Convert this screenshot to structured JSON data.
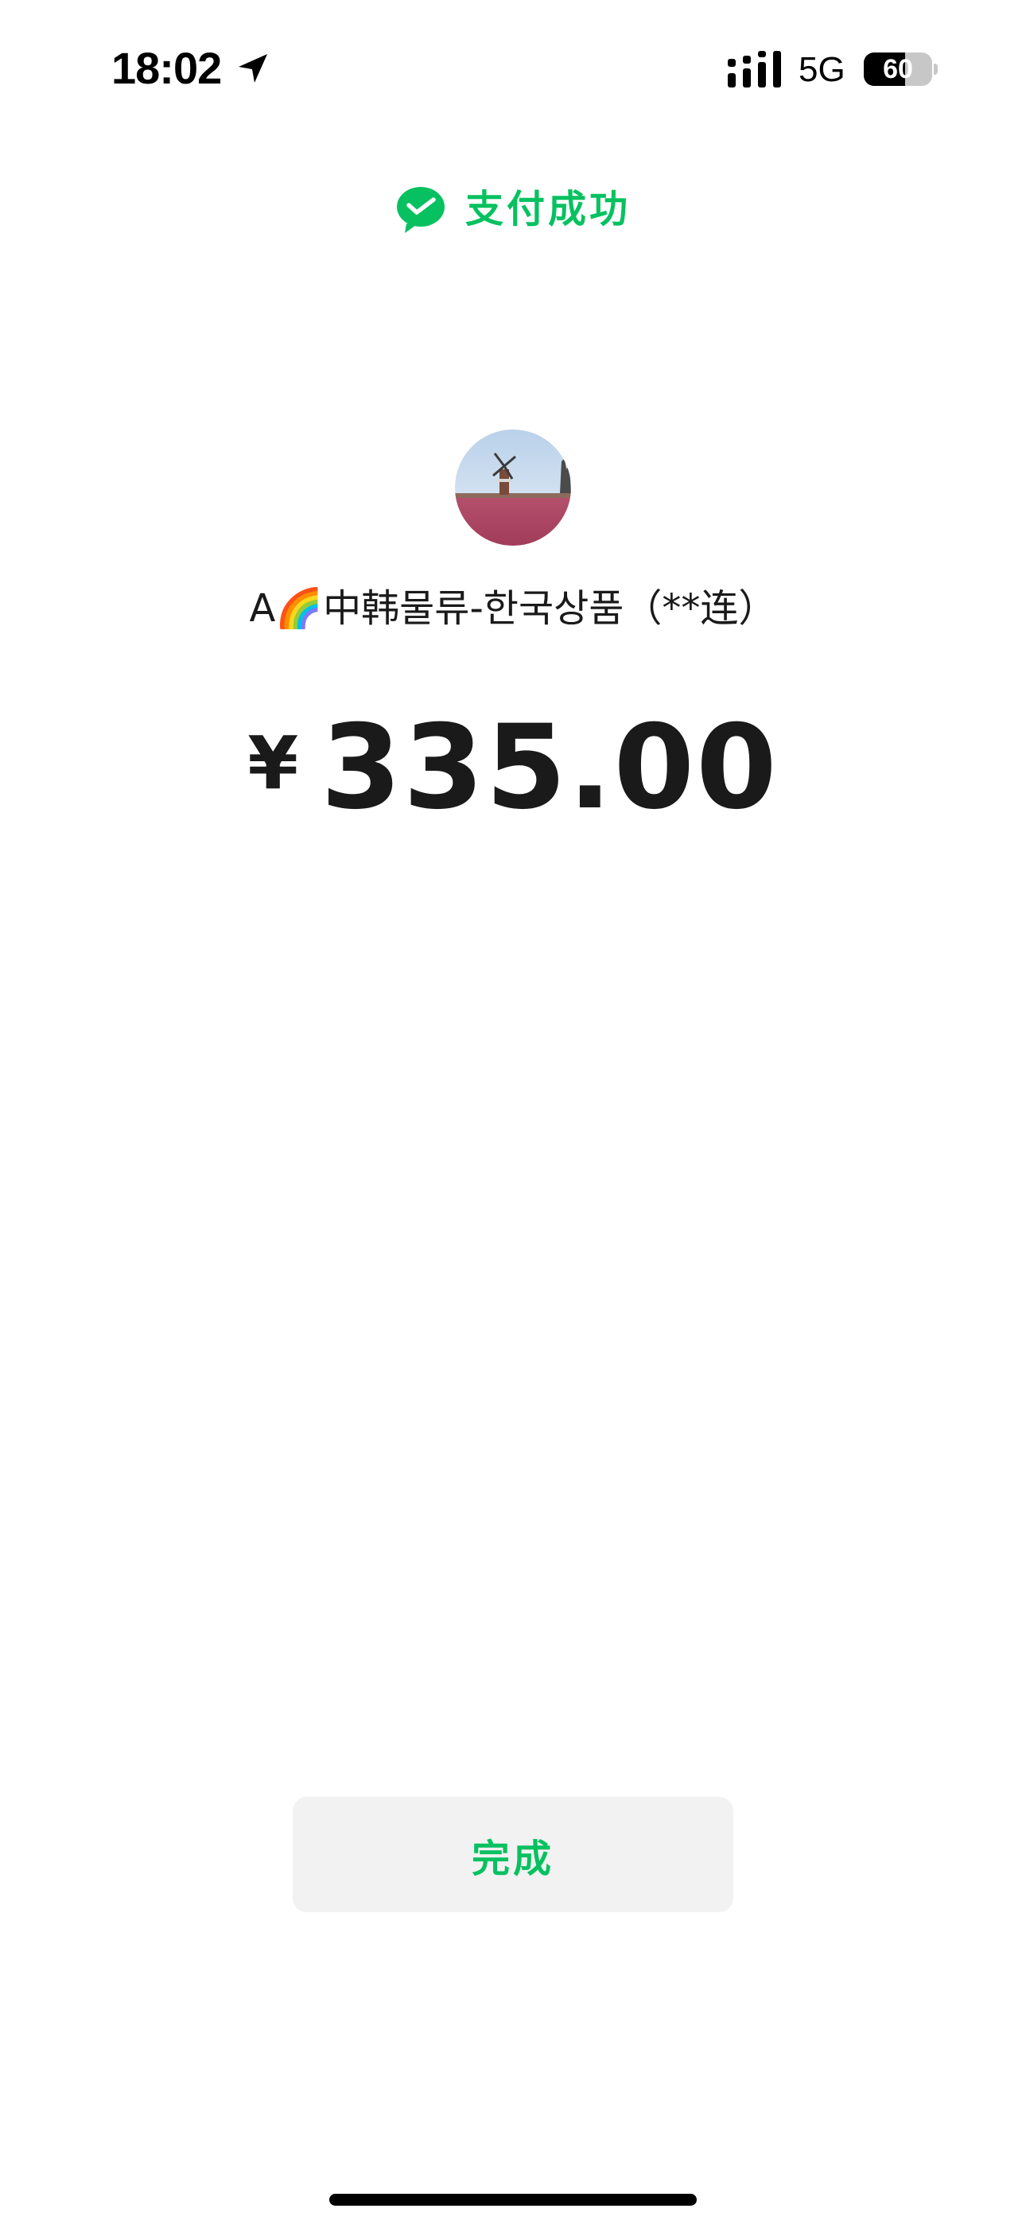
{
  "status_bar": {
    "time": "18:02",
    "network": "5G",
    "battery_level": "60",
    "battery_fraction": 0.6,
    "icons": [
      "location-arrow-icon",
      "cellular-signal-icon",
      "battery-icon"
    ]
  },
  "header": {
    "icon": "wechat-pay-icon",
    "status_text": "支付成功",
    "accent_color": "#07c160"
  },
  "payee": {
    "avatar": "windmill-avatar",
    "name": "A🌈中韩물류-한국상품（**连）"
  },
  "payment": {
    "currency_symbol": "¥",
    "amount": "335.00"
  },
  "actions": {
    "done_label": "完成"
  }
}
